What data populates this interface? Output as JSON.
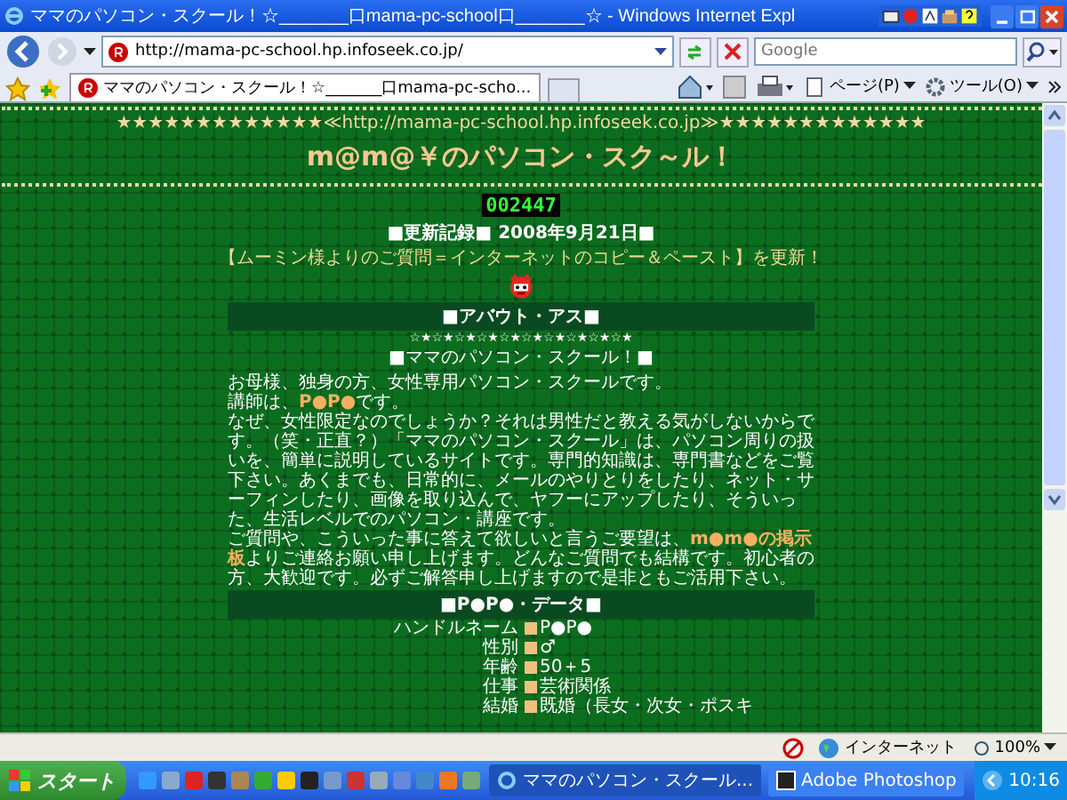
{
  "window": {
    "title": "ママのパソコン・スクール！☆_______口mama-pc-school口_______☆ - Windows Internet Expl"
  },
  "address_bar": {
    "url": "http://mama-pc-school.hp.infoseek.co.jp/"
  },
  "search": {
    "placeholder": "Google"
  },
  "tabs": [
    {
      "label": "ママのパソコン・スクール！☆_______口mama-pc-scho...",
      "selected": true
    }
  ],
  "commands": [
    {
      "label": "ページ(P)"
    },
    {
      "label": "ツール(O)"
    }
  ],
  "page": {
    "banner": "★★★★★★★★★★★★★≪http://mama-pc-school.hp.infoseek.co.jp≫★★★★★★★★★★★★★",
    "heading": "m@m@￥のパソコン・スク～ル！",
    "counter": "002447",
    "update_date": "■更新記録■ 2008年9月21日■",
    "update_note": "【ムーミン様よりのご質問＝インターネットのコピー＆ペースト】を更新！",
    "about": {
      "header": "■アバウト・アス■",
      "stars": "☆★☆★☆★☆★☆★☆★☆★☆★☆★☆★",
      "subtitle": "■ママのパソコン・スクール！■",
      "paragraphs": [
        "お母様、独身の方、女性専用パソコン・スクールです。",
        "講師は、**P●P●**です。",
        "なぜ、女性限定なのでしょうか？それは男性だと教える気がしないからです。（笑・正直？）「ママのパソコン・スクール」は、パソコン周りの扱いを、簡単に説明しているサイトです。専門的知識は、専門書などをご覧下さい。あくまでも、日常的に、メールのやりとりをしたり、ネット・サーフィンしたり、画像を取り込んで、ヤフーにアップしたり、そういった、生活レベルでのパソコン・講座です。",
        "ご質問や、こういった事に答えて欲しいと言うご要望は、**m●m●の掲示板**よりご連絡お願い申し上げます。どんなご質問でも結構です。初心者の方、大歓迎です。必ずご解答申し上げますので是非ともご活用下さい。"
      ]
    },
    "data": {
      "header": "■P●P●・データ■",
      "rows": [
        {
          "label": "ハンドルネーム",
          "value": "P●P●"
        },
        {
          "label": "性別",
          "value": "♂"
        },
        {
          "label": "年齢",
          "value": "50＋5"
        },
        {
          "label": "仕事",
          "value": "芸術関係"
        },
        {
          "label": "結婚",
          "value": "既婚（長女・次女・ポスキ"
        }
      ]
    }
  },
  "status_bar": {
    "zone": "インターネット",
    "zoom": "100%"
  },
  "taskbar": {
    "start": "スタート",
    "tasks": [
      {
        "label": "ママのパソコン・スクール...",
        "selected": true
      },
      {
        "label": "Adobe Photoshop",
        "selected": false
      }
    ],
    "clock": "10:16"
  }
}
